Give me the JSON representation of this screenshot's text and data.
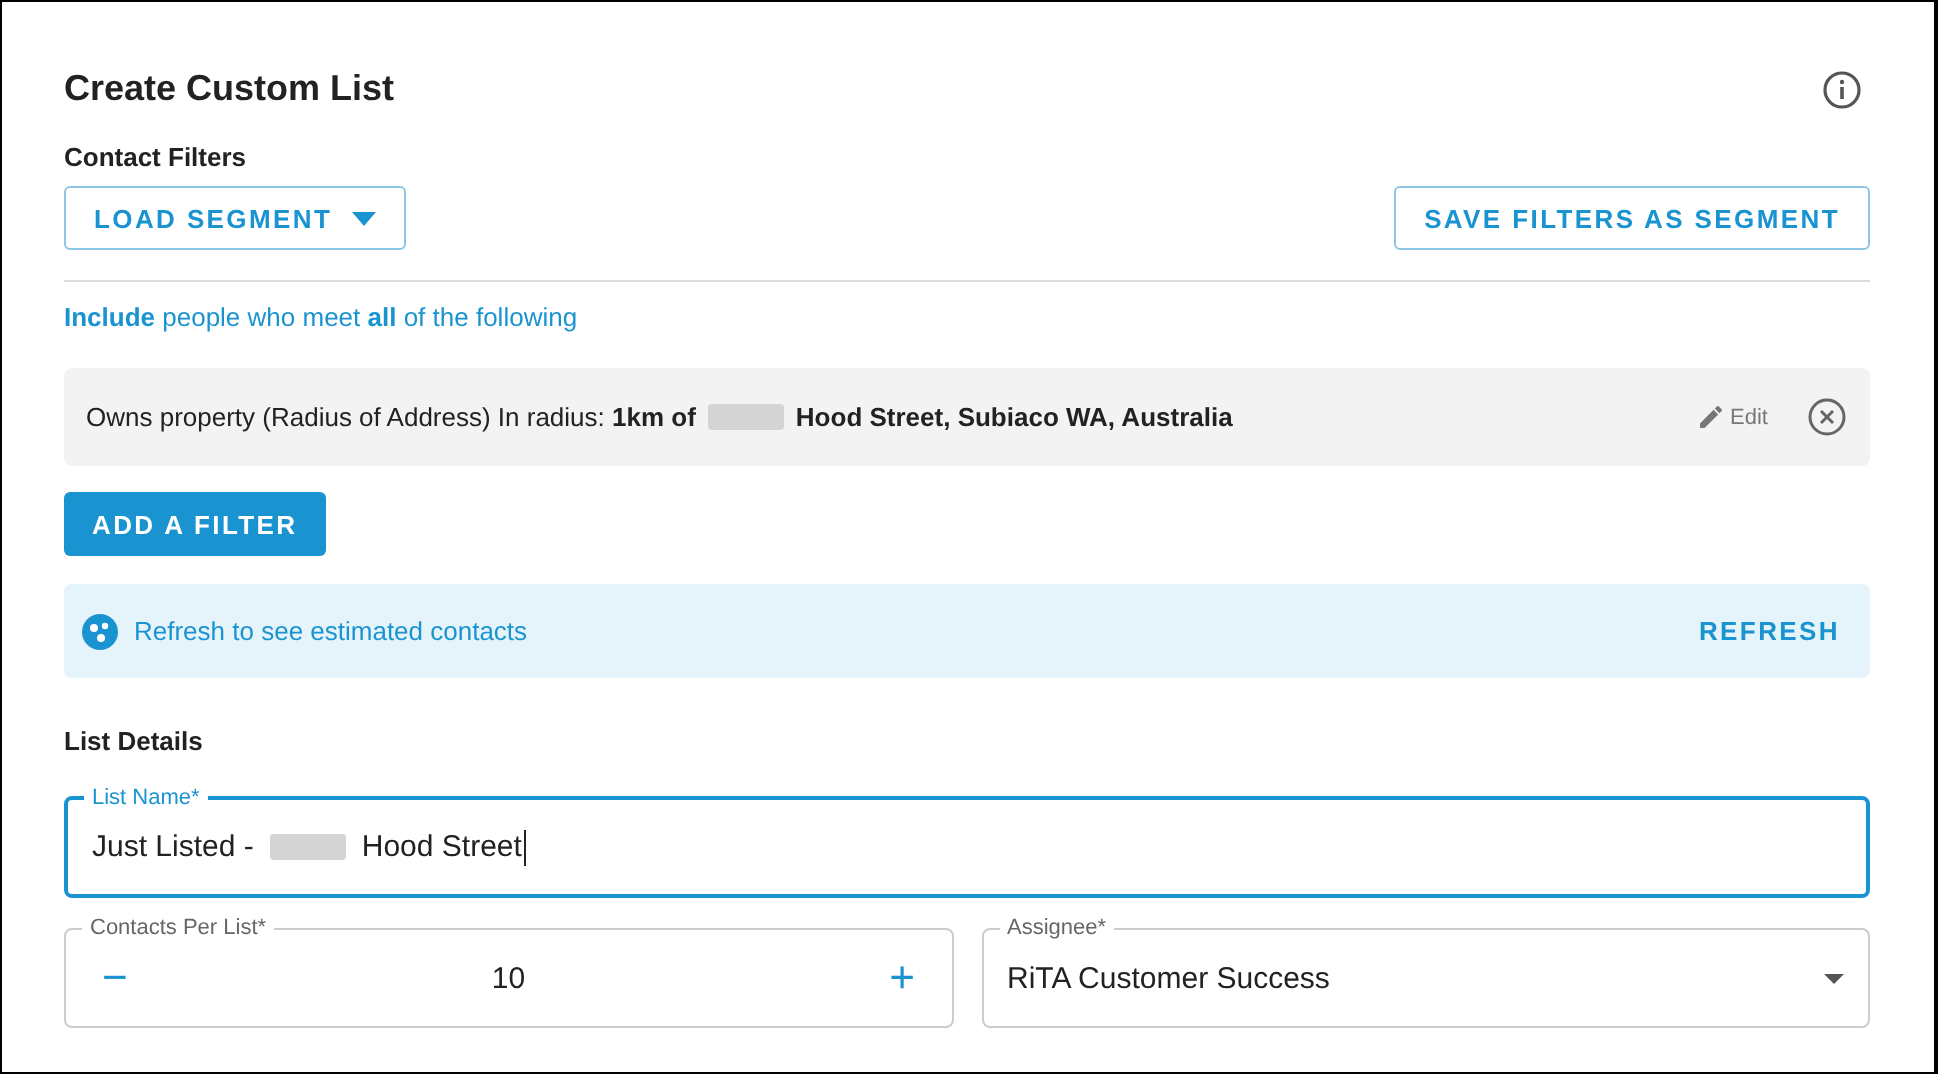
{
  "title": "Create Custom List",
  "contact_filters": {
    "heading": "Contact Filters",
    "load_segment": "LOAD SEGMENT",
    "save_segment": "SAVE FILTERS AS SEGMENT",
    "include_text": "**Include** people who meet **all** of the following",
    "filters": [
      {
        "condition": "Owns property (Radius of Address) In radius: **1km of**",
        "address": "Hood Street, Subiaco WA, Australia",
        "edit": "Edit"
      }
    ],
    "add_filter": "ADD A FILTER"
  },
  "estimate": {
    "message": "Refresh to see estimated contacts",
    "action": "REFRESH"
  },
  "list_details": {
    "heading": "List Details",
    "list_name": {
      "label": "List Name*",
      "value_start": "Just Listed -",
      "value_end": "Hood Street",
      "focused": true
    },
    "contacts_per_list": {
      "label": "Contacts Per List*",
      "value": "10",
      "decrement": "−",
      "increment": "+"
    },
    "assignee": {
      "label": "Assignee*",
      "value": "RiTA Customer Success"
    }
  }
}
